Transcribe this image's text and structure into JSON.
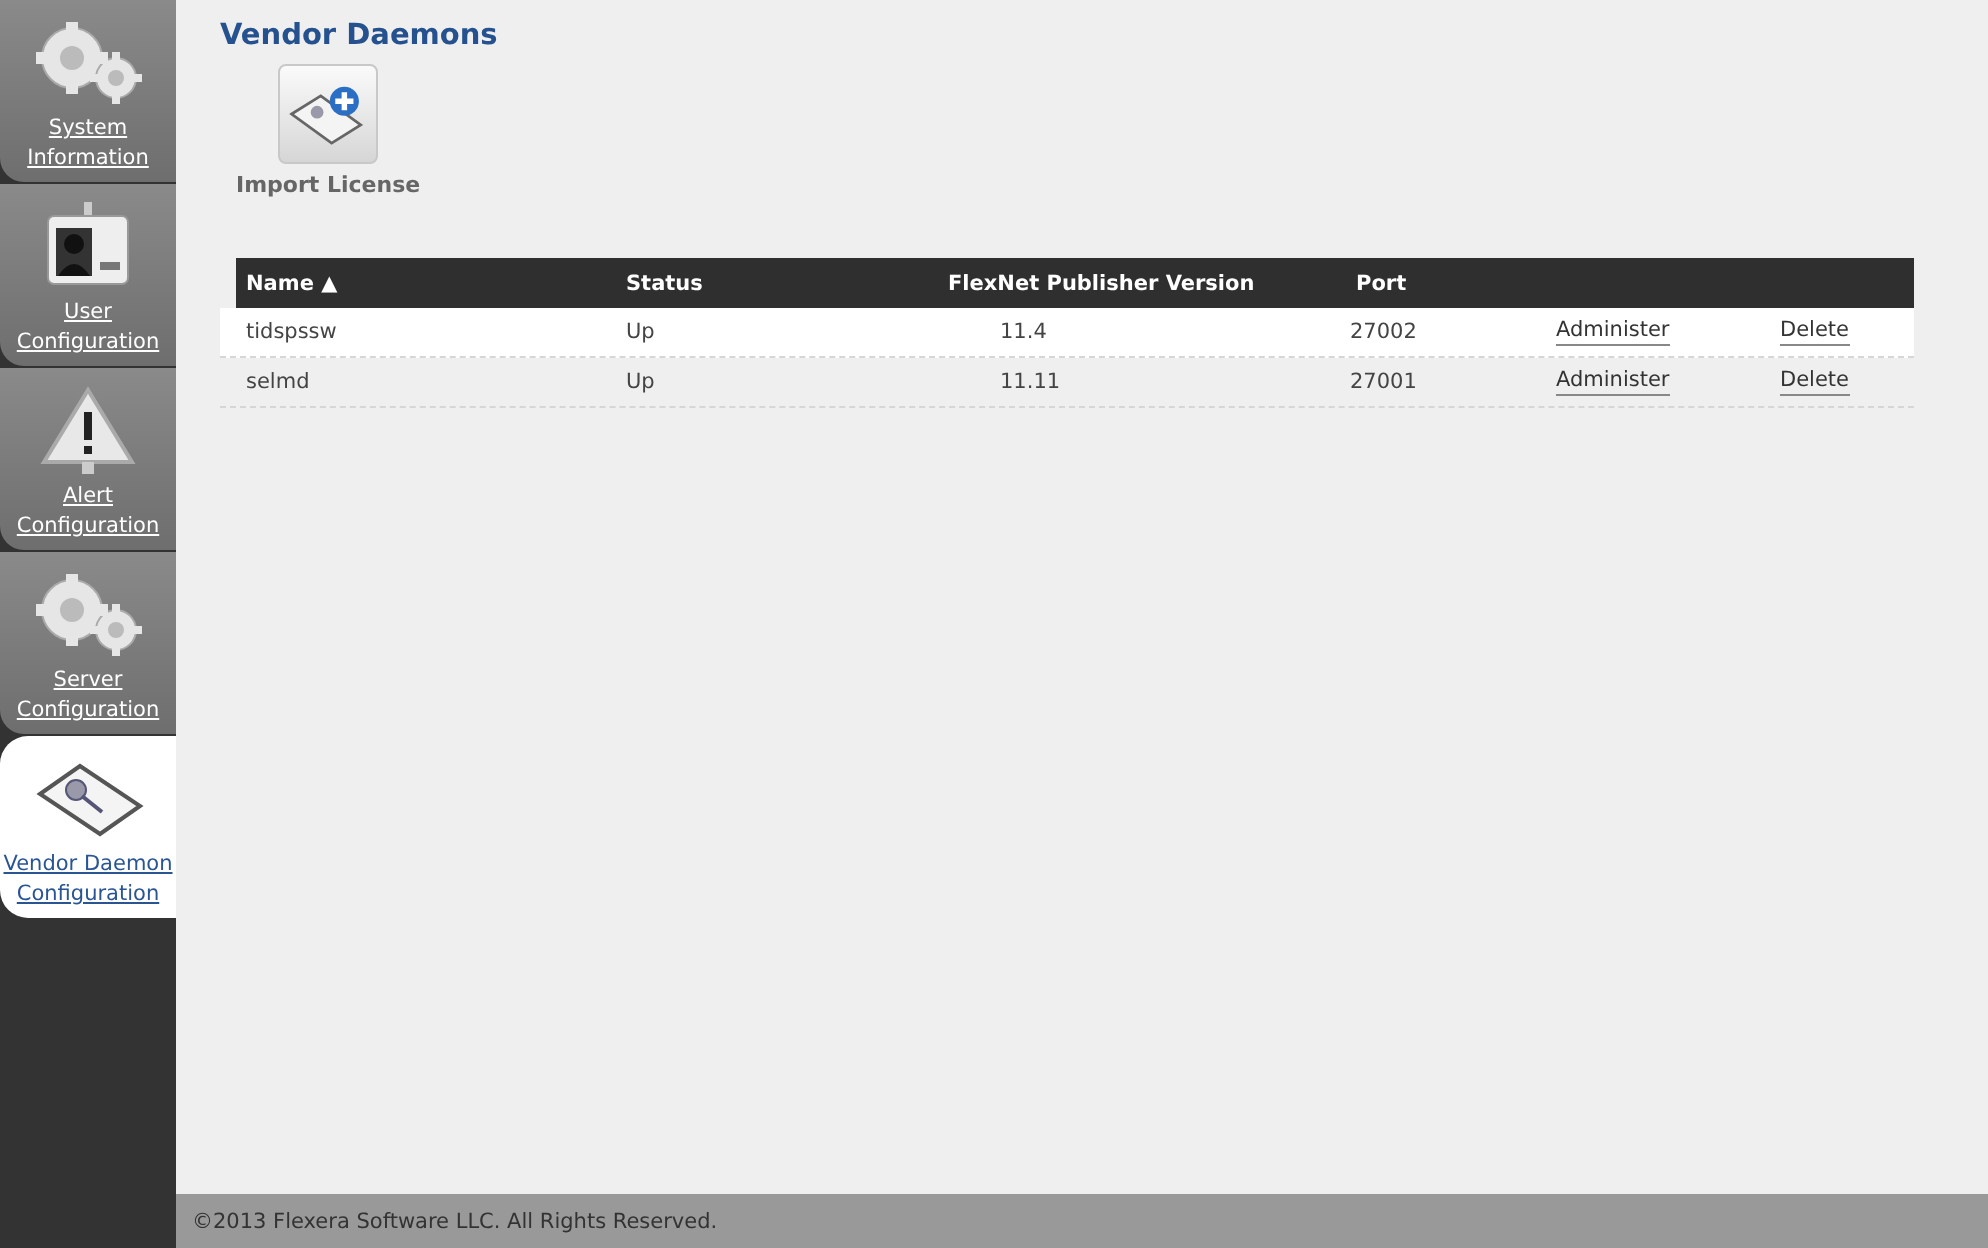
{
  "sidebar": {
    "items": [
      {
        "kind": "gears",
        "label": "System Information",
        "selected": false
      },
      {
        "kind": "badge",
        "label": "User Configuration",
        "selected": false
      },
      {
        "kind": "alert",
        "label": "Alert Configuration",
        "selected": false
      },
      {
        "kind": "gears",
        "label": "Server Configuration",
        "selected": false
      },
      {
        "kind": "certificate",
        "label": "Vendor Daemon Configuration",
        "selected": true
      }
    ]
  },
  "page_title": "Vendor Daemons",
  "import_button": {
    "label": "Import License"
  },
  "table": {
    "columns": [
      {
        "label": "Name",
        "sort": "▲"
      },
      {
        "label": "Status"
      },
      {
        "label": "FlexNet Publisher Version"
      },
      {
        "label": "Port"
      }
    ],
    "rows": [
      {
        "name": "tidspssw",
        "status": "Up",
        "version": "11.4",
        "port": "27002",
        "actions": [
          "Administer",
          "Delete"
        ],
        "selected": true
      },
      {
        "name": "selmd",
        "status": "Up",
        "version": "11.11",
        "port": "27001",
        "actions": [
          "Administer",
          "Delete"
        ],
        "selected": false
      }
    ]
  },
  "footer": "©2013 Flexera Software LLC. All Rights Reserved."
}
